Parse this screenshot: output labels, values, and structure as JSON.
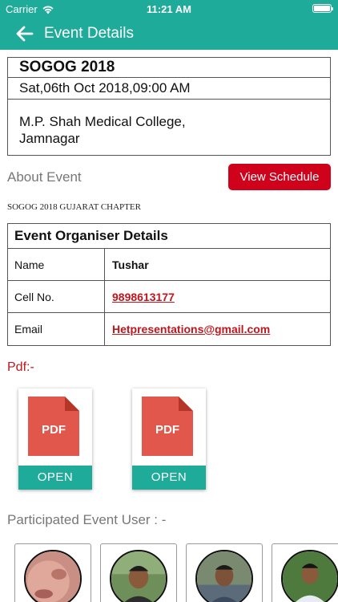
{
  "status_bar": {
    "carrier": "Carrier",
    "time": "11:21 AM"
  },
  "nav": {
    "title": "Event Details",
    "back_icon": "arrow-left-icon"
  },
  "event": {
    "name": "SOGOG 2018",
    "datetime": "Sat,06th Oct 2018,09:00 AM",
    "venue_line1": "M.P. Shah Medical College,",
    "venue_line2": "Jamnagar"
  },
  "about": {
    "label": "About Event",
    "schedule_button": "View Schedule",
    "description": "SOGOG 2018 GUJARAT CHAPTER"
  },
  "organiser": {
    "heading": "Event Organiser Details",
    "rows": [
      {
        "key": "Name",
        "value": "Tushar"
      },
      {
        "key": "Cell No.",
        "value": "9898613177"
      },
      {
        "key": "Email",
        "value": "Hetpresentations@gmail.com"
      }
    ]
  },
  "pdf": {
    "label": "Pdf:-",
    "items": [
      {
        "doc_text": "PDF",
        "open_label": "OPEN"
      },
      {
        "doc_text": "PDF",
        "open_label": "OPEN"
      }
    ]
  },
  "participants": {
    "label": "Participated Event User : -",
    "count_visible": 4
  },
  "colors": {
    "accent": "#1fab9a",
    "primary_red": "#d0021b",
    "link_red": "#c0161d",
    "pdf_red": "#e2574c"
  }
}
